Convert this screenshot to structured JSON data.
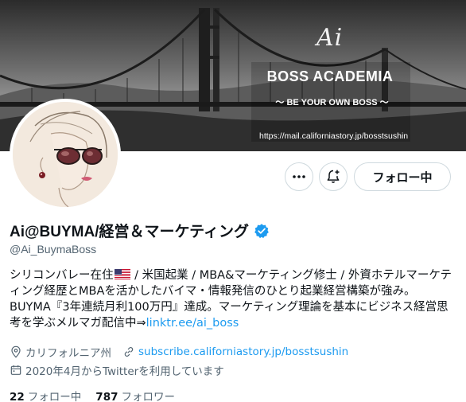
{
  "banner": {
    "script_text": "Ai",
    "title": "BOSS ACADEMIA",
    "tagline": "〜 BE YOUR OWN BOSS 〜",
    "url": "https://mail.californiastory.jp/bosstsushin"
  },
  "actions": {
    "more_icon": "more-dots-icon",
    "notify_icon": "bell-plus-icon",
    "follow_label": "フォロー中"
  },
  "profile": {
    "display_name": "Ai@BUYMA/経営＆マーケティング",
    "verified_icon": "verified-badge-icon",
    "handle": "@Ai_BuymaBoss"
  },
  "bio": {
    "line1_a": "シリコンバレー在住",
    "flag": "us-flag",
    "line1_b": " / 米国起業 / MBA&マーケティング修士 / 外資ホテルマーケテ",
    "line2": "ィング経歴とMBAを活かしたバイマ・情報発信のひとり起業経営構築が強み。",
    "line3": "BUYMA『3年連続月利100万円』達成。マーケティング理論を基本にビジネス経営思",
    "line4": "考を学ぶメルマガ配信中⇒",
    "link": "linktr.ee/ai_boss"
  },
  "meta": {
    "location_icon": "location-pin-icon",
    "location": "カリフォルニア州",
    "link_icon": "link-icon",
    "website": "subscribe.californiastory.jp/bosstsushin",
    "calendar_icon": "calendar-icon",
    "joined": "2020年4月からTwitterを利用しています"
  },
  "stats": {
    "following_count": "22",
    "following_label": "フォロー中",
    "followers_count": "787",
    "followers_label": "フォロワー"
  },
  "colors": {
    "accent": "#1d9bf0",
    "text": "#0f1419",
    "muted": "#536471",
    "border": "#cfd9de"
  }
}
